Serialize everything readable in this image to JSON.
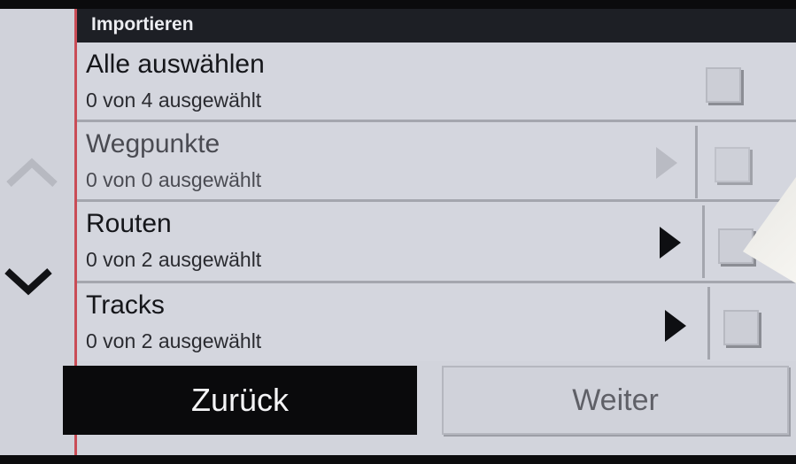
{
  "header": {
    "title": "Importieren"
  },
  "rows": [
    {
      "title": "Alle auswählen",
      "subtitle": "0 von 4 ausgewählt",
      "has_arrow": false,
      "enabled": true
    },
    {
      "title": "Wegpunkte",
      "subtitle": "0 von 0 ausgewählt",
      "has_arrow": true,
      "enabled": false
    },
    {
      "title": "Routen",
      "subtitle": "0 von 2 ausgewählt",
      "has_arrow": true,
      "enabled": true
    },
    {
      "title": "Tracks",
      "subtitle": "0 von 2 ausgewählt",
      "has_arrow": true,
      "enabled": true
    }
  ],
  "footer": {
    "back_label": "Zurück",
    "next_label": "Weiter"
  },
  "icons": {
    "scroll_up": "chevron-up-icon",
    "scroll_down": "chevron-down-icon",
    "row_arrow": "triangle-right-icon",
    "checkbox": "checkbox-icon"
  },
  "colors": {
    "header_bg": "#1d1f25",
    "accent_line": "#c94c56",
    "back_button_bg": "#0a0a0c"
  }
}
